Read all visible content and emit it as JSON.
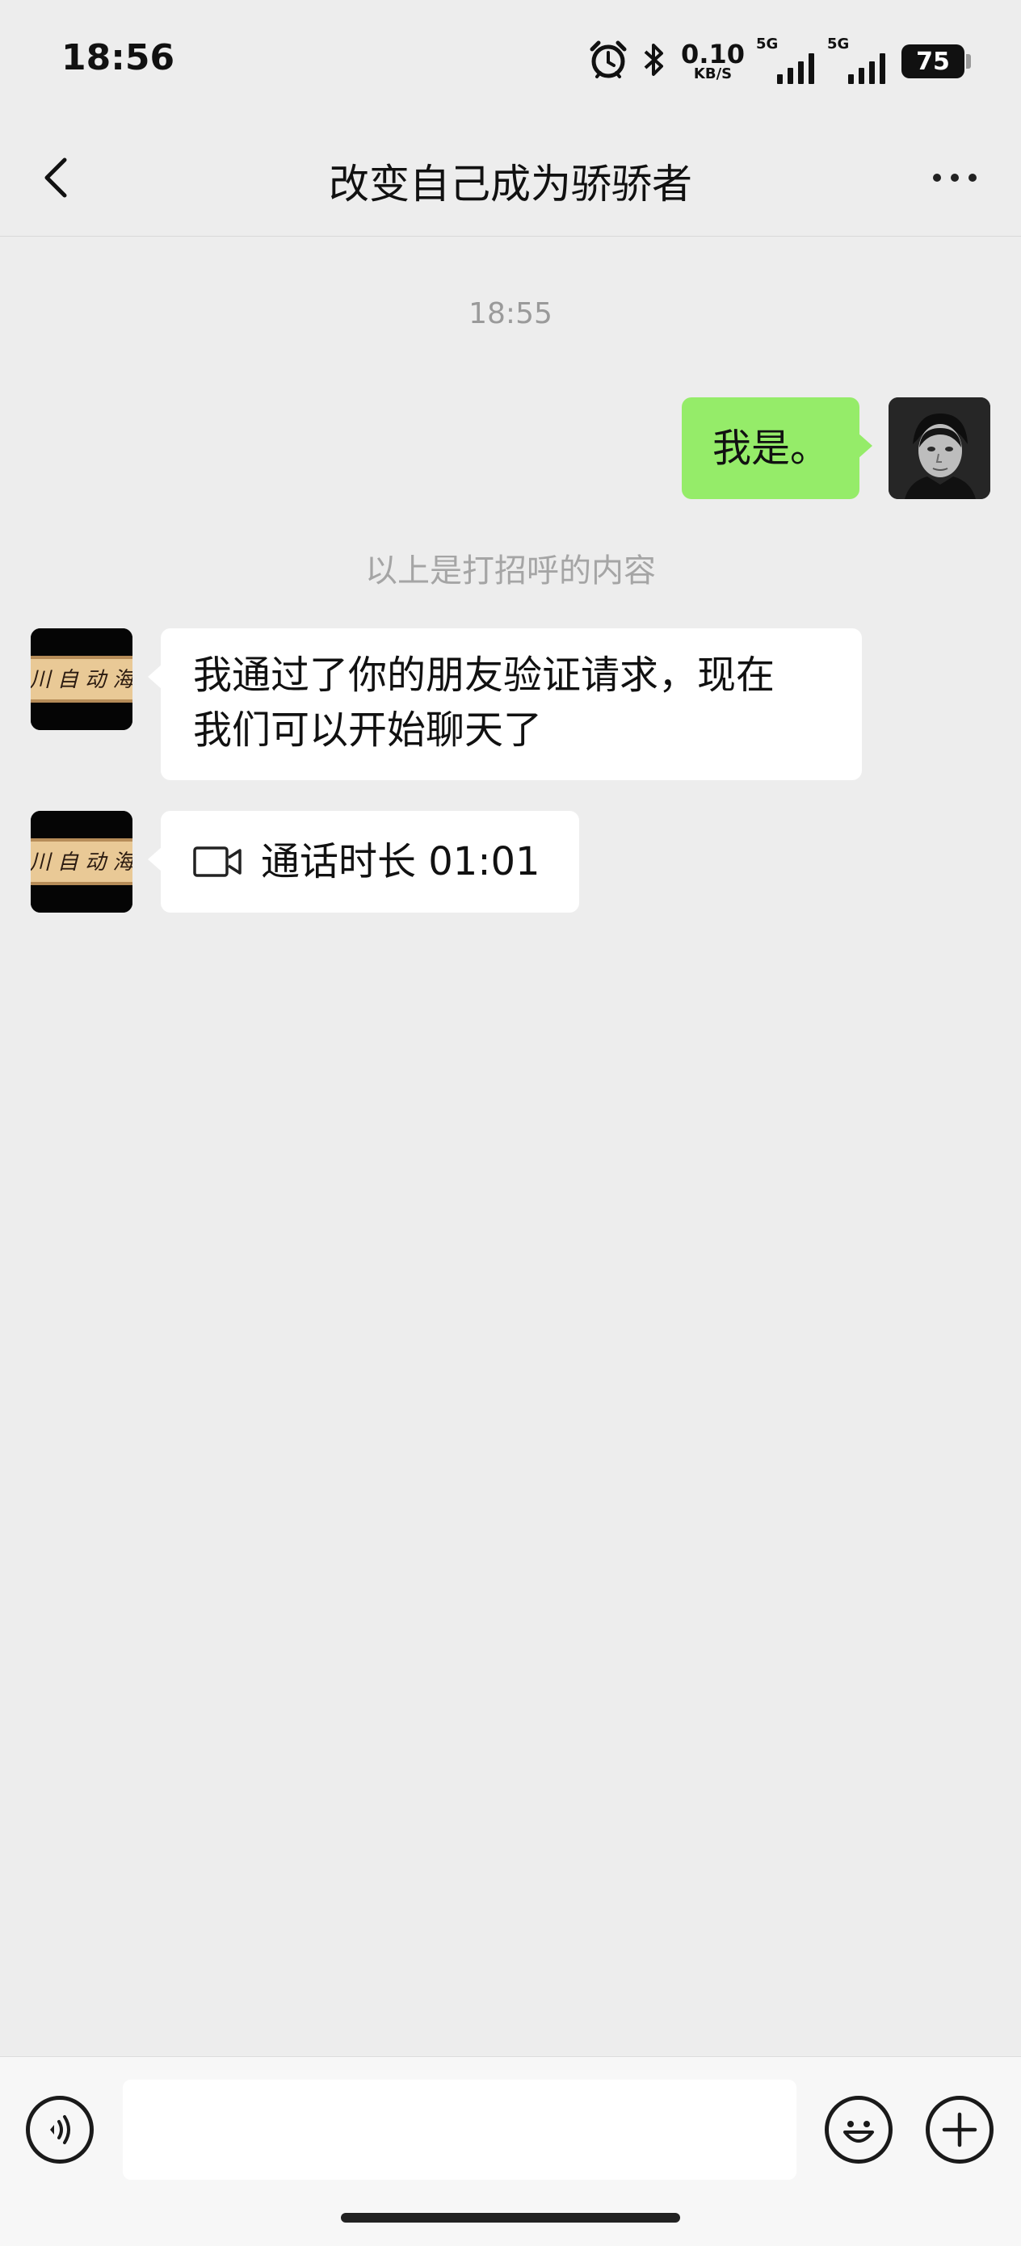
{
  "status_bar": {
    "time": "18:56",
    "net_speed_value": "0.10",
    "net_speed_unit": "KB/S",
    "sim1_label": "5G",
    "sim2_label": "5G",
    "battery": "75",
    "icons": [
      "alarm-icon",
      "bluetooth-icon",
      "signal-icon",
      "battery-icon"
    ]
  },
  "header": {
    "title": "改变自己成为骄骄者",
    "icons": [
      "back-chevron-icon",
      "more-dots-icon"
    ]
  },
  "chat": {
    "timestamp": "18:55",
    "messages": [
      {
        "sender": "me",
        "text": "我是。"
      },
      {
        "sender": "system",
        "text": "以上是打招呼的内容"
      },
      {
        "sender": "other",
        "text_line1": "我通过了你的朋友验证请求，现在",
        "text_line2": "我们可以开始聊天了"
      },
      {
        "sender": "other",
        "type": "video-call",
        "text": "通话时长 01:01"
      }
    ],
    "other_avatar_text": "川 自 动 海"
  },
  "input_bar": {
    "text_value": "",
    "icons": [
      "voice-icon",
      "emoji-icon",
      "plus-icon"
    ]
  },
  "colors": {
    "background": "#ededed",
    "my_bubble": "#95ec69",
    "other_bubble": "#ffffff"
  }
}
